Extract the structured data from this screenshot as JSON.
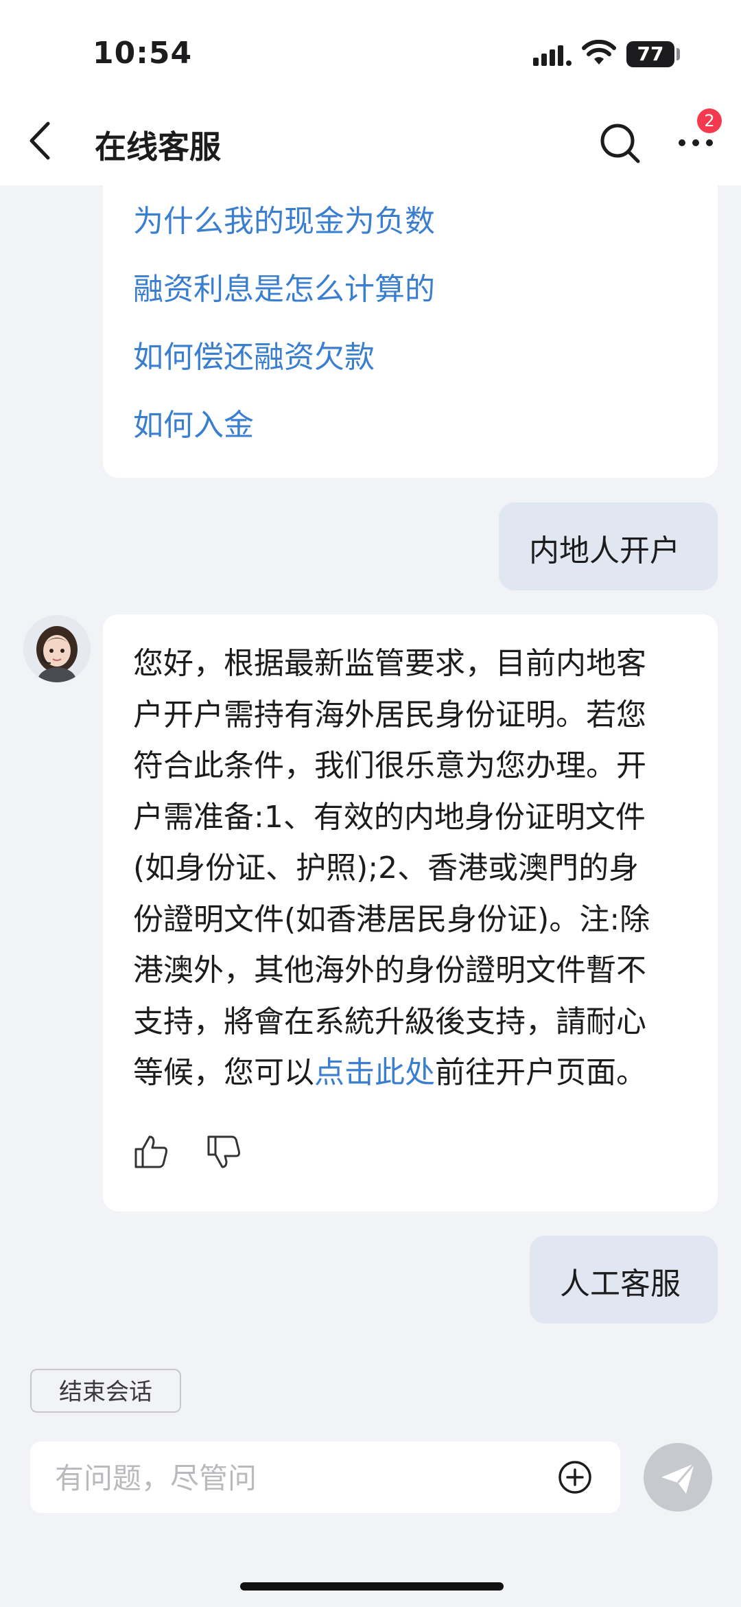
{
  "status_bar": {
    "time": "10:54",
    "battery": "77"
  },
  "header": {
    "title": "在线客服",
    "badge_count": "2"
  },
  "faq": {
    "items": [
      "为什么我的现金为负数",
      "融资利息是怎么计算的",
      "如何偿还融资欠款",
      "如何入金"
    ]
  },
  "messages": {
    "user_1": "内地人开户",
    "bot_answer": {
      "lines": [
        "您好，根据最新监管要求，目前内地客",
        "户开户需持有海外居民身份证明。若您",
        "符合此条件，我们很乐意为您办理。开",
        "户需准备:1、有效的内地身份证明文件",
        "(如身份证、护照);2、香港或澳門的身",
        "份證明文件(如香港居民身份证)。注:除",
        "港澳外，其他海外的身份證明文件暫不",
        "支持，將會在系統升級後支持，請耐心"
      ],
      "last_line_prefix": "等候，您可以",
      "link_text": "点击此处",
      "last_line_suffix": "前往开户页面。"
    },
    "user_2": "人工客服"
  },
  "footer": {
    "end_session_label": "结束会话",
    "input_placeholder": "有问题，尽管问",
    "input_value": ""
  },
  "icons": {
    "back": "back-arrow-icon",
    "search": "search-icon",
    "more": "more-dots-icon",
    "like": "thumbs-up-icon",
    "dislike": "thumbs-down-icon",
    "plus": "plus-circle-icon",
    "send": "send-icon"
  },
  "colors": {
    "link": "#3a7ed0",
    "badge": "#f2394e",
    "user_bubble": "#e1e7f1",
    "background": "#f2f3f6"
  }
}
